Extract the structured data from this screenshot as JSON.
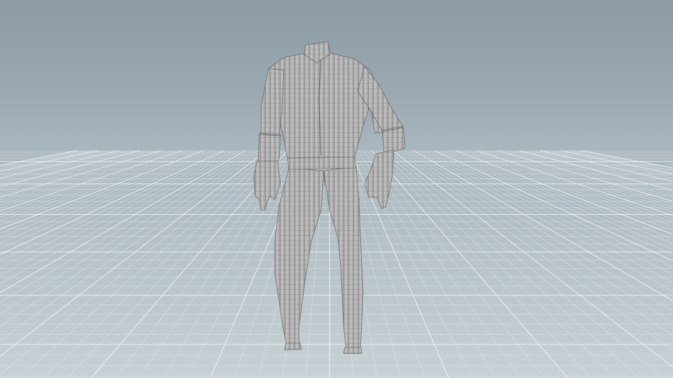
{
  "viewport": {
    "sky_color_top": "#8b9aa4",
    "sky_color_horizon": "#aebbc2",
    "floor_color": "#bfcad0",
    "grid_color": "#ffffff",
    "garment_color": "#b3b3b3",
    "wireframe_color": "#5c5c5c"
  },
  "scene": {
    "object": "mannequin-garment-wireframe",
    "grid": true
  }
}
